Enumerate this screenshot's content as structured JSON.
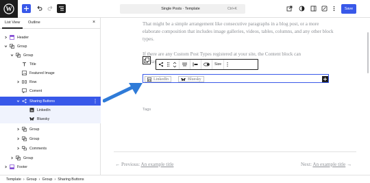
{
  "topbar": {
    "document_title": "Single Posts · Template",
    "shortcut": "Ctrl+K",
    "save_label": "Save"
  },
  "sidebar": {
    "tabs": [
      "List View",
      "Outline"
    ],
    "tree": [
      {
        "label": "Header",
        "icon": "template-part-icon",
        "expanded": false
      },
      {
        "label": "Group",
        "icon": "group-icon",
        "expanded": true
      },
      {
        "label": "Group",
        "icon": "group-icon",
        "expanded": true
      },
      {
        "label": "Title",
        "icon": "title-icon"
      },
      {
        "label": "Featured Image",
        "icon": "image-icon"
      },
      {
        "label": "Row",
        "icon": "row-icon",
        "expanded": false
      },
      {
        "label": "Coment",
        "icon": "comment-icon"
      },
      {
        "label": "Sharing Buttons",
        "icon": "share-icon",
        "selected": true,
        "expanded": true
      },
      {
        "label": "LinkedIn",
        "icon": "linkedin-icon"
      },
      {
        "label": "Bluesky",
        "icon": "bluesky-icon"
      },
      {
        "label": "Group",
        "icon": "group-icon",
        "expanded": false
      },
      {
        "label": "Group",
        "icon": "group-icon",
        "expanded": false
      },
      {
        "label": "Comments",
        "icon": "comments-icon",
        "expanded": false
      },
      {
        "label": "Group",
        "icon": "group-icon",
        "expanded": false
      },
      {
        "label": "Footer",
        "icon": "template-part-icon",
        "expanded": false
      }
    ]
  },
  "canvas": {
    "paragraph1": "That might be a simple arrangement like consecutive paragraphs in a blog post, or a more elaborate composition that includes image galleries, videos, tables, columns, and any other block types.",
    "paragraph2_line1": "If there are any Custom Post Types registered at your site, the Content block can",
    "paragraph2_line2": "display",
    "toolbar_size_label": "Size",
    "share_buttons": [
      "LinkedIn",
      "Bluesky"
    ],
    "tags_label": "Tags",
    "nav_prev_prefix": "← Previous:",
    "nav_prev_link": "An example title",
    "nav_next_prefix": "Next:",
    "nav_next_link": "An example title",
    "nav_next_arrow": "→"
  },
  "breadcrumbs": [
    "Template",
    "Group",
    "Group",
    "Sharing Buttons"
  ],
  "colors": {
    "accent": "#3858e9",
    "dark": "#1e1e1e",
    "muted_text": "#8c8f94",
    "annotation_arrow": "#2f7bd8"
  }
}
